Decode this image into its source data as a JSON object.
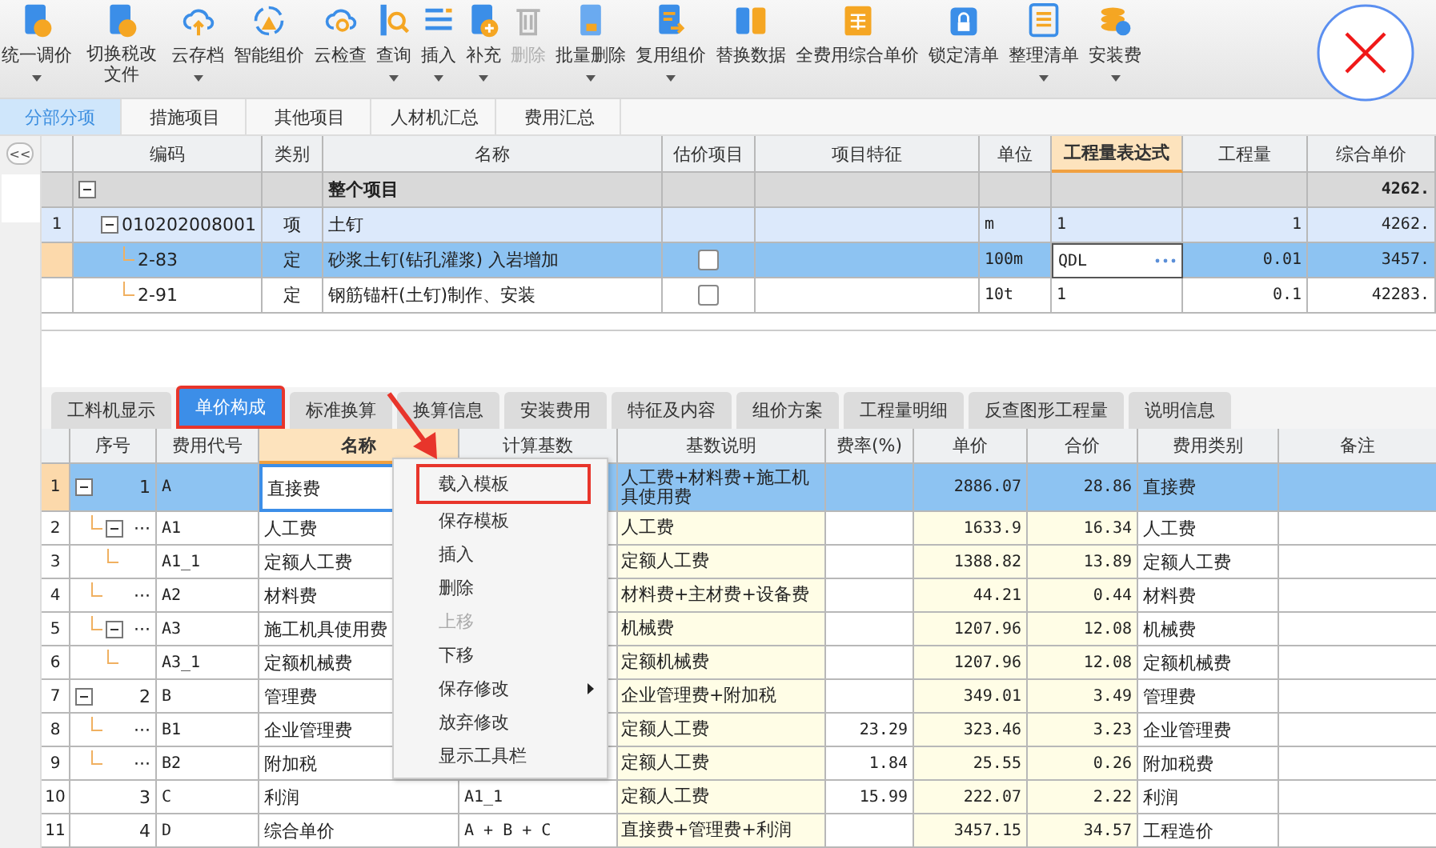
{
  "toolbar": [
    {
      "label": "统一调价",
      "dropdown": true,
      "disabled": false
    },
    {
      "label": "切换税改文件",
      "dropdown": false,
      "disabled": false
    },
    {
      "label": "云存档",
      "dropdown": true,
      "disabled": false
    },
    {
      "label": "智能组价",
      "dropdown": false,
      "disabled": false
    },
    {
      "label": "云检查",
      "dropdown": false,
      "disabled": false
    },
    {
      "label": "查询",
      "dropdown": true,
      "disabled": false
    },
    {
      "label": "插入",
      "dropdown": true,
      "disabled": false
    },
    {
      "label": "补充",
      "dropdown": true,
      "disabled": false
    },
    {
      "label": "删除",
      "dropdown": false,
      "disabled": true
    },
    {
      "label": "批量删除",
      "dropdown": true,
      "disabled": false
    },
    {
      "label": "复用组价",
      "dropdown": true,
      "disabled": false
    },
    {
      "label": "替换数据",
      "dropdown": false,
      "disabled": false
    },
    {
      "label": "全费用综合单价",
      "dropdown": false,
      "disabled": false
    },
    {
      "label": "锁定清单",
      "dropdown": false,
      "disabled": false
    },
    {
      "label": "整理清单",
      "dropdown": true,
      "disabled": false
    },
    {
      "label": "安装费",
      "dropdown": true,
      "disabled": false
    }
  ],
  "tabs": [
    {
      "label": "分部分项",
      "selected": true
    },
    {
      "label": "措施项目",
      "selected": false
    },
    {
      "label": "其他项目",
      "selected": false
    },
    {
      "label": "人材机汇总",
      "selected": false
    },
    {
      "label": "费用汇总",
      "selected": false
    }
  ],
  "side_panel": {
    "collapse_label": "<<"
  },
  "item_grid": {
    "columns": [
      "编码",
      "类别",
      "名称",
      "估价项目",
      "项目特征",
      "单位",
      "工程量表达式",
      "工程量",
      "综合单价"
    ],
    "rows": [
      {
        "kind": "total",
        "name": "整个项目",
        "price": "4262.",
        "selected": false,
        "expanded": true,
        "children": [
          {
            "kind": "item",
            "no": "1",
            "code": "010202008001",
            "type": "项",
            "name": "土钉",
            "unit": "m",
            "expr": "1",
            "qty": "1",
            "price": "4262.",
            "selected": false,
            "expanded": true,
            "children": [
              {
                "kind": "quota",
                "code": "2-83",
                "type": "定",
                "name": "砂浆土钉(钻孔灌浆) 入岩增加",
                "estimate": false,
                "unit": "100m",
                "expr": "QDL",
                "qty": "0.01",
                "price": "3457.",
                "selected": true,
                "editing": true
              },
              {
                "kind": "quota",
                "code": "2-91",
                "type": "定",
                "name": "钢筋锚杆(土钉)制作、安装",
                "estimate": false,
                "unit": "10t",
                "expr": "1",
                "qty": "0.1",
                "price": "42283.",
                "selected": false,
                "editing": false
              }
            ]
          }
        ]
      }
    ]
  },
  "detail_tabs": [
    {
      "label": "工料机显示",
      "selected": false,
      "highlighted": false
    },
    {
      "label": "单价构成",
      "selected": true,
      "highlighted": true
    },
    {
      "label": "标准换算",
      "selected": false,
      "highlighted": false
    },
    {
      "label": "换算信息",
      "selected": false,
      "highlighted": false
    },
    {
      "label": "安装费用",
      "selected": false,
      "highlighted": false
    },
    {
      "label": "特征及内容",
      "selected": false,
      "highlighted": false
    },
    {
      "label": "组价方案",
      "selected": false,
      "highlighted": false
    },
    {
      "label": "工程量明细",
      "selected": false,
      "highlighted": false
    },
    {
      "label": "反查图形工程量",
      "selected": false,
      "highlighted": false
    },
    {
      "label": "说明信息",
      "selected": false,
      "highlighted": false
    }
  ],
  "cost_grid": {
    "columns": [
      "序号",
      "费用代号",
      "名称",
      "计算基数",
      "基数说明",
      "费率(%)",
      "单价",
      "合价",
      "费用类别",
      "备注"
    ],
    "rows": [
      {
        "no": "1",
        "seq": "1",
        "code": "A",
        "name": "直接费",
        "base_desc": "人工费+材料费+施工机具使用费",
        "unit_price": "2886.07",
        "total": "28.86",
        "category": "直接费",
        "selected": true,
        "editing": true,
        "expanded": true,
        "children": [
          {
            "no": "2",
            "seq": "···",
            "code": "A1",
            "name": "人工费",
            "base_desc": "人工费",
            "unit_price": "1633.9",
            "total": "16.34",
            "category": "人工费",
            "selected": false,
            "editing": false,
            "expanded": true,
            "children": [
              {
                "no": "3",
                "code": "A1_1",
                "name": "定额人工费",
                "base_desc": "定额人工费",
                "unit_price": "1388.82",
                "total": "13.89",
                "category": "定额人工费",
                "selected": false,
                "editing": false
              }
            ]
          },
          {
            "no": "4",
            "seq": "···",
            "code": "A2",
            "name": "材料费",
            "base_desc": "材料费+主材费+设备费",
            "unit_price": "44.21",
            "total": "0.44",
            "category": "材料费",
            "selected": false,
            "editing": false
          },
          {
            "no": "5",
            "seq": "···",
            "code": "A3",
            "name": "施工机具使用费",
            "base_desc": "机械费",
            "unit_price": "1207.96",
            "total": "12.08",
            "category": "机械费",
            "selected": false,
            "editing": false,
            "expanded": true,
            "children": [
              {
                "no": "6",
                "code": "A3_1",
                "name": "定额机械费",
                "base_desc": "定额机械费",
                "unit_price": "1207.96",
                "total": "12.08",
                "category": "定额机械费",
                "selected": false,
                "editing": false
              }
            ]
          }
        ]
      },
      {
        "no": "7",
        "seq": "2",
        "code": "B",
        "name": "管理费",
        "base_desc": "企业管理费+附加税",
        "unit_price": "349.01",
        "total": "3.49",
        "category": "管理费",
        "selected": false,
        "editing": false,
        "expanded": true,
        "children": [
          {
            "no": "8",
            "seq": "···",
            "code": "B1",
            "name": "企业管理费",
            "base_desc": "定额人工费",
            "rate": "23.29",
            "unit_price": "323.46",
            "total": "3.23",
            "category": "企业管理费",
            "selected": false,
            "editing": false
          },
          {
            "no": "9",
            "seq": "···",
            "code": "B2",
            "name": "附加税",
            "base_desc": "定额人工费",
            "rate": "1.84",
            "unit_price": "25.55",
            "total": "0.26",
            "category": "附加税费",
            "selected": false,
            "editing": false
          }
        ]
      },
      {
        "no": "10",
        "seq": "3",
        "code": "C",
        "name": "利润",
        "base": "A1_1",
        "base_desc": "定额人工费",
        "rate": "15.99",
        "unit_price": "222.07",
        "total": "2.22",
        "category": "利润",
        "selected": false,
        "editing": false
      },
      {
        "no": "11",
        "seq": "4",
        "code": "D",
        "name": "综合单价",
        "base": "A + B + C",
        "base_desc": "直接费+管理费+利润",
        "unit_price": "3457.15",
        "total": "34.57",
        "category": "工程造价",
        "selected": false,
        "editing": false
      }
    ]
  },
  "context_menu": {
    "items": [
      {
        "label": "载入模板",
        "disabled": false,
        "submenu": false,
        "highlighted": true
      },
      {
        "label": "保存模板",
        "disabled": false,
        "submenu": false,
        "highlighted": false
      },
      {
        "label": "插入",
        "disabled": false,
        "submenu": false,
        "highlighted": false
      },
      {
        "label": "删除",
        "disabled": false,
        "submenu": false,
        "highlighted": false
      },
      {
        "label": "上移",
        "disabled": true,
        "submenu": false,
        "highlighted": false
      },
      {
        "label": "下移",
        "disabled": false,
        "submenu": false,
        "highlighted": false
      },
      {
        "label": "保存修改",
        "disabled": false,
        "submenu": true,
        "highlighted": false
      },
      {
        "label": "放弃修改",
        "disabled": false,
        "submenu": false,
        "highlighted": false
      },
      {
        "label": "显示工具栏",
        "disabled": false,
        "submenu": false,
        "highlighted": false
      }
    ]
  }
}
